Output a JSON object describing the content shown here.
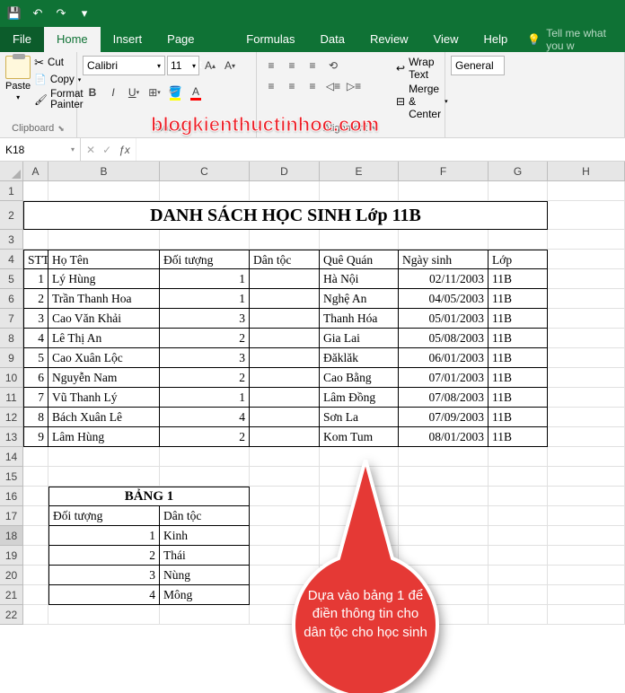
{
  "qat": {
    "save": "💾",
    "undo": "↶",
    "redo": "↷",
    "custom": "▾"
  },
  "tabs": {
    "file": "File",
    "home": "Home",
    "insert": "Insert",
    "pagelayout": "Page Layout",
    "formulas": "Formulas",
    "data": "Data",
    "review": "Review",
    "view": "View",
    "help": "Help"
  },
  "tellme": "Tell me what you w",
  "clip": {
    "paste": "Paste",
    "cut": "Cut",
    "copy": "Copy",
    "fp": "Format Painter",
    "label": "Clipboard"
  },
  "font": {
    "name": "Calibri",
    "size": "11",
    "label": "Font"
  },
  "align": {
    "wrap": "Wrap Text",
    "merge": "Merge & Center",
    "label": "Alignment"
  },
  "number": {
    "general": "General"
  },
  "namebox": "K18",
  "fx": "ƒx",
  "cols": [
    "A",
    "B",
    "C",
    "D",
    "E",
    "F",
    "G",
    "H"
  ],
  "title": "DANH SÁCH HỌC SINH Lớp 11B",
  "header": [
    "STT",
    "Họ Tên",
    "Đối tượng",
    "Dân tộc",
    "Quê Quán",
    "Ngày sinh",
    "Lớp"
  ],
  "rows": [
    [
      "1",
      "Lý Hùng",
      "1",
      "",
      "Hà Nội",
      "02/11/2003",
      "11B"
    ],
    [
      "2",
      "Trần Thanh Hoa",
      "1",
      "",
      "Nghệ An",
      "04/05/2003",
      "11B"
    ],
    [
      "3",
      "Cao Văn Khải",
      "3",
      "",
      "Thanh Hóa",
      "05/01/2003",
      "11B"
    ],
    [
      "4",
      "Lê Thị An",
      "2",
      "",
      "Gia Lai",
      "05/08/2003",
      "11B"
    ],
    [
      "5",
      "Cao Xuân Lộc",
      "3",
      "",
      "Đăklăk",
      "06/01/2003",
      "11B"
    ],
    [
      "6",
      "Nguyễn Nam",
      "2",
      "",
      "Cao Bằng",
      "07/01/2003",
      "11B"
    ],
    [
      "7",
      "Vũ Thanh Lý",
      "1",
      "",
      "Lâm Đồng",
      "07/08/2003",
      "11B"
    ],
    [
      "8",
      "Bách Xuân Lê",
      "4",
      "",
      "Sơn La",
      "07/09/2003",
      "11B"
    ],
    [
      "9",
      "Lâm Hùng",
      "2",
      "",
      "Kom Tum",
      "08/01/2003",
      "11B"
    ]
  ],
  "t2": {
    "title": "BẢNG 1",
    "h1": "Đối tượng",
    "h2": "Dân tộc",
    "rows": [
      [
        "1",
        "Kinh"
      ],
      [
        "2",
        "Thái"
      ],
      [
        "3",
        "Nùng"
      ],
      [
        "4",
        "Mông"
      ]
    ]
  },
  "callout": "Dựa vào bảng 1 để điền thông tin cho dân tộc cho học sinh",
  "watermark": "blogkienthuctinhoc.com"
}
